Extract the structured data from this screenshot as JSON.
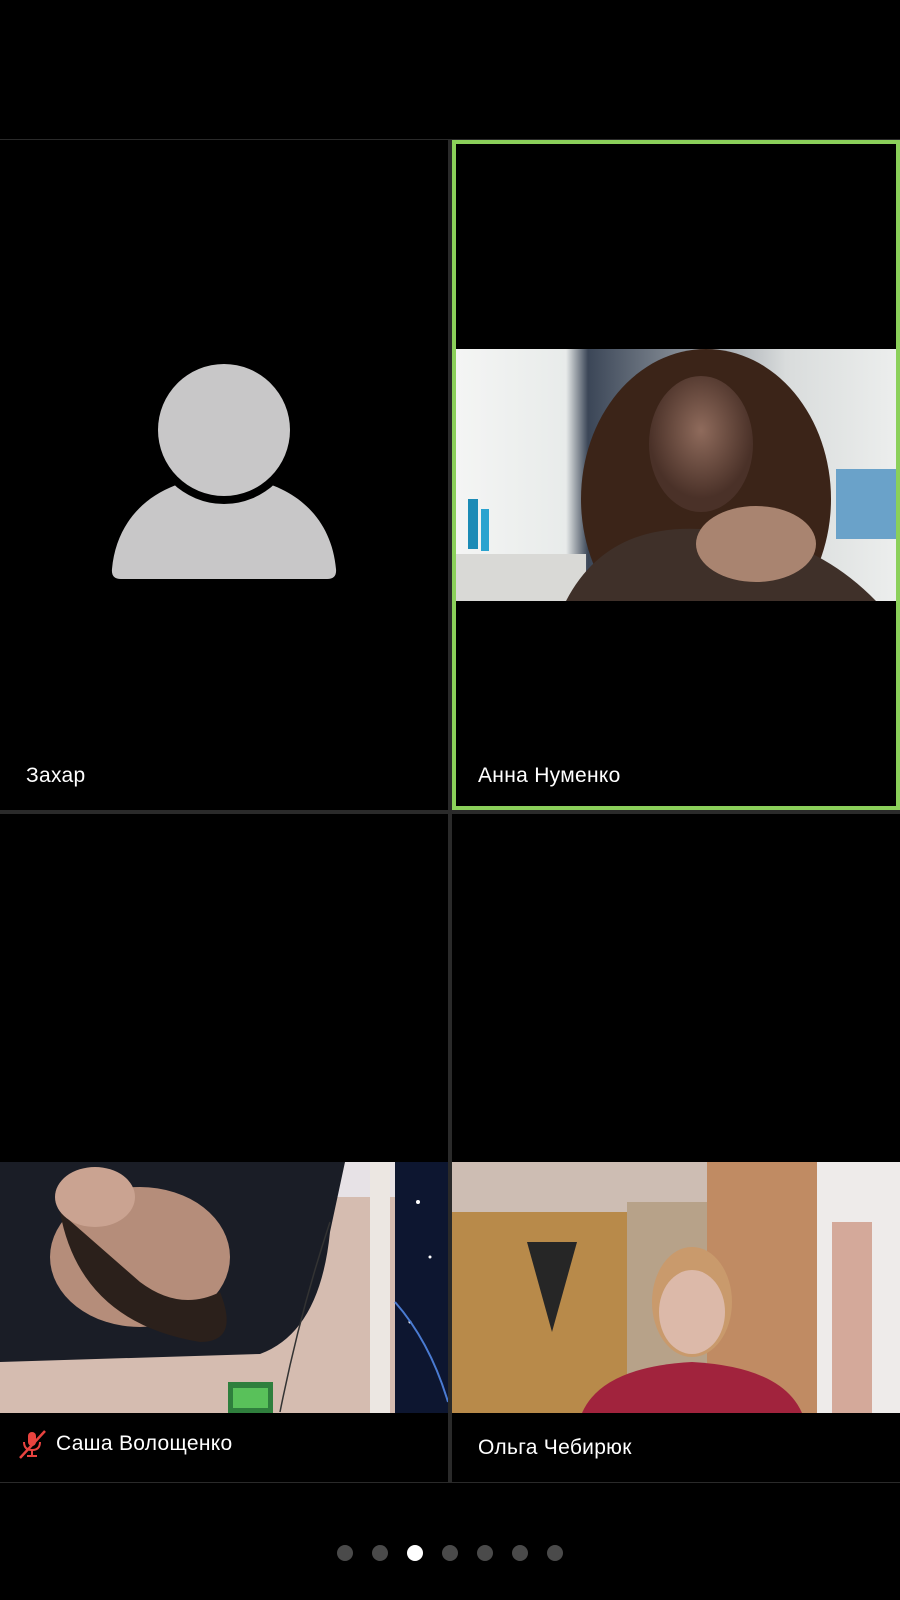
{
  "participants": [
    {
      "name": "Захар",
      "video": false,
      "muted": false,
      "active_speaker": false
    },
    {
      "name": "Анна Нуменко",
      "video": true,
      "muted": false,
      "active_speaker": true
    },
    {
      "name": "Саша Волощенко",
      "video": true,
      "muted": true,
      "active_speaker": false
    },
    {
      "name": "Ольга Чебирюк",
      "video": true,
      "muted": false,
      "active_speaker": false
    }
  ],
  "colors": {
    "active_speaker_border": "#8bd05a",
    "muted_icon": "#e8433f",
    "avatar": "#c8c7c8"
  },
  "pager": {
    "total_pages": 7,
    "current_page": 3
  },
  "icons": {
    "avatar": "person-placeholder-icon",
    "muted": "microphone-muted-icon"
  }
}
